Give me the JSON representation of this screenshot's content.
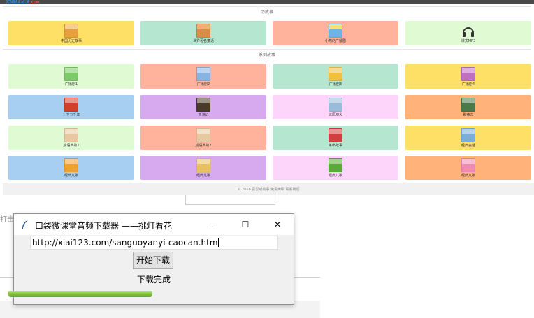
{
  "site": {
    "logo_text": "xiai123",
    "logo_suffix": ".COM",
    "section1_title": "历故事",
    "section2_title": "系列故事",
    "footer_text": "© 2016 喜爱听故事   免责声明   联系我们",
    "row1": [
      {
        "label": "中国历史故事",
        "color": "#ffe066",
        "thumb": "#e8a03c"
      },
      {
        "label": "世界著名童话",
        "color": "#b5e6cf",
        "thumb": "#d88c4a"
      },
      {
        "label": "小燕的广播剧",
        "color": "#ffb39c",
        "thumb": "#6fb2e8"
      },
      {
        "label": "课文MP3",
        "color": "#e0fbd4",
        "icon": "headphones-icon"
      }
    ],
    "grid": [
      {
        "label": "广播剧1",
        "color": "#e0fbd4",
        "thumb": "#7ec96a"
      },
      {
        "label": "广播剧2",
        "color": "#ffb39c",
        "thumb": "#8ab4e0"
      },
      {
        "label": "广播剧3",
        "color": "#b5e6cf",
        "thumb": "#f0c040"
      },
      {
        "label": "广播剧4",
        "color": "#ffe066",
        "thumb": "#c070c0"
      },
      {
        "label": "上下五千年",
        "color": "#a6cff2",
        "thumb": "#d0402a"
      },
      {
        "label": "西游记",
        "color": "#d7aaf0",
        "thumb": "#4a3a2a"
      },
      {
        "label": "三国演义",
        "color": "#fdd5fb",
        "thumb": "#9abcd8"
      },
      {
        "label": "聊斋志",
        "color": "#ffb27a",
        "thumb": "#4a7a4a"
      },
      {
        "label": "成语典故1",
        "color": "#e0fbd4",
        "thumb": "#e8c8a0"
      },
      {
        "label": "成语典故2",
        "color": "#ffb39c",
        "thumb": "#e8c8a0"
      },
      {
        "label": "革命故事",
        "color": "#b5e6cf",
        "thumb": "#d04040"
      },
      {
        "label": "经典童话",
        "color": "#ffe066",
        "thumb": "#7ab0d8"
      },
      {
        "label": "经典儿歌",
        "color": "#a6cff2",
        "thumb": "#f0a030"
      },
      {
        "label": "经典儿歌",
        "color": "#d7aaf0",
        "thumb": "#e8c060"
      },
      {
        "label": "经典儿歌",
        "color": "#fdd5fb",
        "thumb": "#5aaa3a"
      },
      {
        "label": "经典儿歌",
        "color": "#ffb27a",
        "thumb": "#f08ab0"
      }
    ]
  },
  "background": {
    "partial_text": "打击"
  },
  "dialog": {
    "title": "口袋微课堂音频下载器 ——挑灯看花",
    "minimize": "—",
    "maximize": "☐",
    "close": "✕",
    "url_value": "http://xiai123.com/sanguoyanyi-caocan.htm",
    "start_button": "开始下载",
    "status_text": "下载完成",
    "progress_fraction": 1.0
  },
  "colors": {
    "progress_green": "#7fbf3a",
    "dialog_bg": "#f0f0f0",
    "topbar": "#4a4a4a"
  }
}
